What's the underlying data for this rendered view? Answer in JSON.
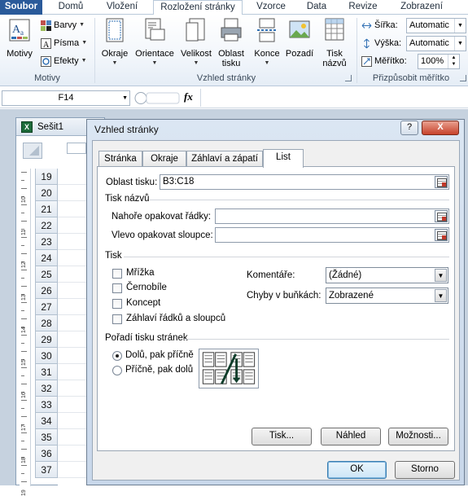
{
  "ribbon_tabs": [
    "Soubor",
    "Domů",
    "Vložení",
    "Rozložení stránky",
    "Vzorce",
    "Data",
    "Revize",
    "Zobrazení"
  ],
  "ribbon": {
    "motivy": {
      "button": "Motivy",
      "barvy": "Barvy",
      "pisma": "Písma",
      "efekty": "Efekty",
      "group": "Motivy"
    },
    "vzhled": {
      "okraje": "Okraje",
      "orientace": "Orientace",
      "velikost": "Velikost",
      "oblast_line1": "Oblast",
      "oblast_line2": "tisku",
      "konce": "Konce",
      "pozadi": "Pozadí",
      "tisk_line1": "Tisk",
      "tisk_line2": "názvů",
      "group": "Vzhled stránky"
    },
    "prizpusobit": {
      "sirka_label": "Šířka:",
      "sirka_value": "Automatic",
      "vyska_label": "Výška:",
      "vyska_value": "Automatic",
      "meritko_label": "Měřítko:",
      "meritko_value": "100%",
      "group": "Přizpůsobit měřítko"
    }
  },
  "formula_bar": {
    "name_box": "F14",
    "fx": "fx"
  },
  "workbook": {
    "title": "Sešit1",
    "rows": [
      "19",
      "20",
      "21",
      "22",
      "23",
      "24",
      "25",
      "26",
      "27",
      "28",
      "29",
      "30",
      "31",
      "32",
      "33",
      "34",
      "35",
      "36",
      "37"
    ],
    "ruler_numbers": [
      "10",
      "11",
      "12",
      "13",
      "14",
      "15",
      "16",
      "17",
      "18",
      "19"
    ]
  },
  "dialog": {
    "title": "Vzhled stránky",
    "help": "?",
    "close": "X",
    "tabs": [
      "Stránka",
      "Okraje",
      "Záhlaví a zápatí",
      "List"
    ],
    "oblast_tisku_label": "Oblast tisku:",
    "oblast_tisku_value": "B3:C18",
    "tisk_nazvu_section": "Tisk názvů",
    "nahore_label": "Nahoře opakovat řádky:",
    "vlevo_label": "Vlevo opakovat sloupce:",
    "tisk_section": "Tisk",
    "checkboxes": [
      "Mřížka",
      "Černobíle",
      "Koncept",
      "Záhlaví řádků a sloupců"
    ],
    "komentare_label": "Komentáře:",
    "komentare_value": "(Žádné)",
    "chyby_label": "Chyby v buňkách:",
    "chyby_value": "Zobrazené",
    "poradi_section": "Pořadí tisku stránek",
    "radio_dolu": "Dolů, pak příčně",
    "radio_pricne": "Příčně, pak dolů",
    "btn_tisk": "Tisk...",
    "btn_nahled": "Náhled",
    "btn_moznosti": "Možnosti...",
    "btn_ok": "OK",
    "btn_storno": "Storno"
  }
}
